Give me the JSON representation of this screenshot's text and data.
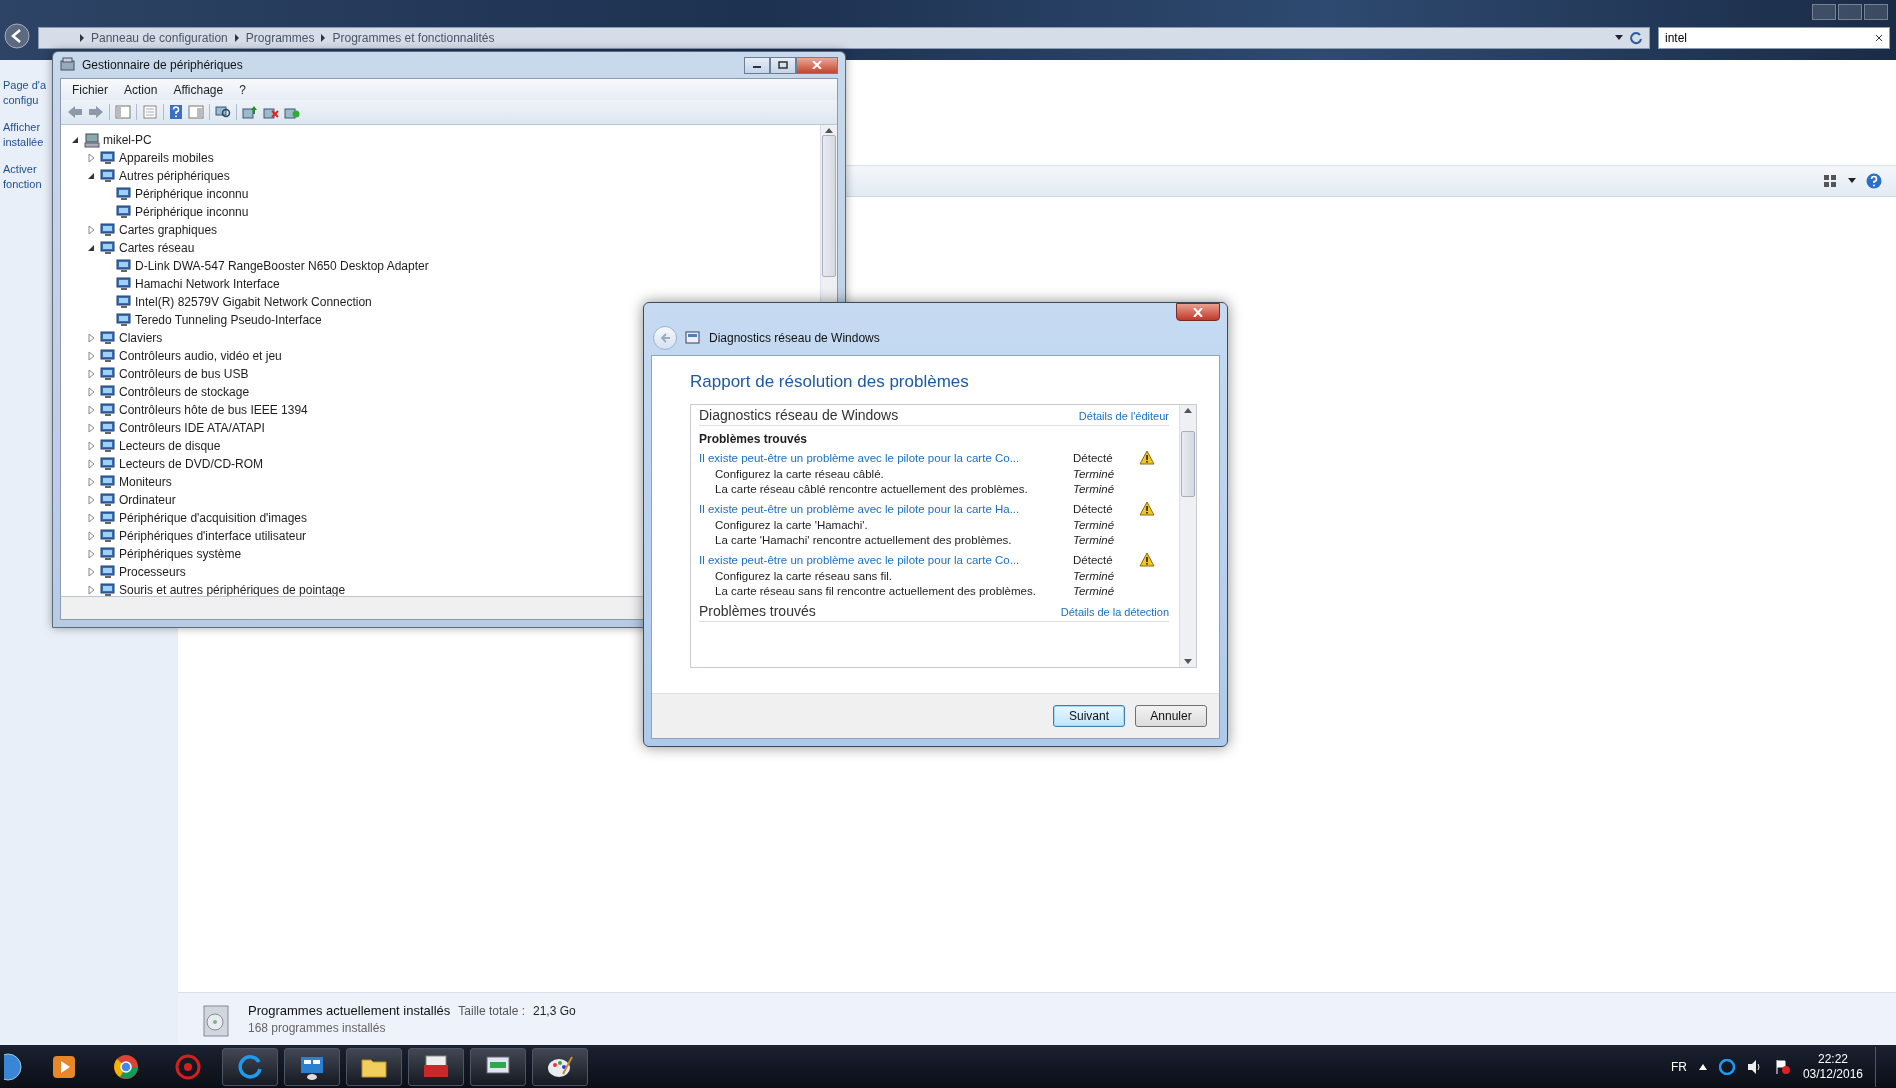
{
  "control_panel": {
    "breadcrumb": [
      "Panneau de configuration",
      "Programmes",
      "Programmes et fonctionnalités"
    ],
    "search": {
      "value": "intel"
    },
    "side_links": [
      {
        "lines": [
          "Page d'a",
          "configu"
        ]
      },
      {
        "lines": [
          "Afficher",
          "installée"
        ]
      },
      {
        "lines": [
          "Activer",
          "fonction"
        ]
      }
    ],
    "details": {
      "title": "Programmes actuellement installés",
      "size_label": "Taille totale :",
      "size_value": "21,3 Go",
      "count": "168 programmes installés"
    }
  },
  "device_manager": {
    "title": "Gestionnaire de périphériques",
    "menu": [
      "Fichier",
      "Action",
      "Affichage",
      "?"
    ],
    "tree": {
      "label": "mikel-PC",
      "expanded": true,
      "children": [
        {
          "label": "Appareils mobiles",
          "expanded": false
        },
        {
          "label": "Autres périphériques",
          "expanded": true,
          "children": [
            {
              "label": "Périphérique inconnu"
            },
            {
              "label": "Périphérique inconnu"
            }
          ]
        },
        {
          "label": "Cartes graphiques",
          "expanded": false
        },
        {
          "label": "Cartes réseau",
          "expanded": true,
          "children": [
            {
              "label": "D-Link DWA-547 RangeBooster N650 Desktop Adapter"
            },
            {
              "label": "Hamachi Network Interface"
            },
            {
              "label": "Intel(R) 82579V Gigabit Network Connection"
            },
            {
              "label": "Teredo Tunneling Pseudo-Interface"
            }
          ]
        },
        {
          "label": "Claviers",
          "expanded": false
        },
        {
          "label": "Contrôleurs audio, vidéo et jeu",
          "expanded": false
        },
        {
          "label": "Contrôleurs de bus USB",
          "expanded": false
        },
        {
          "label": "Contrôleurs de stockage",
          "expanded": false
        },
        {
          "label": "Contrôleurs hôte de bus IEEE 1394",
          "expanded": false
        },
        {
          "label": "Contrôleurs IDE ATA/ATAPI",
          "expanded": false
        },
        {
          "label": "Lecteurs de disque",
          "expanded": false
        },
        {
          "label": "Lecteurs de DVD/CD-ROM",
          "expanded": false
        },
        {
          "label": "Moniteurs",
          "expanded": false
        },
        {
          "label": "Ordinateur",
          "expanded": false
        },
        {
          "label": "Périphérique d'acquisition d'images",
          "expanded": false
        },
        {
          "label": "Périphériques d'interface utilisateur",
          "expanded": false
        },
        {
          "label": "Périphériques système",
          "expanded": false
        },
        {
          "label": "Processeurs",
          "expanded": false
        },
        {
          "label": "Souris et autres périphériques de pointage",
          "expanded": false
        }
      ]
    }
  },
  "dialog": {
    "title": "Diagnostics réseau de Windows",
    "heading": "Rapport de résolution des problèmes",
    "sections": [
      {
        "kind": "header",
        "title": "Diagnostics réseau de Windows",
        "link": "Détails de l'éditeur"
      },
      {
        "kind": "problems",
        "title": "Problèmes trouvés",
        "problems": [
          {
            "text": "Il existe peut-être un problème avec le pilote pour la carte Co...",
            "status": "Détecté",
            "steps": [
              {
                "text": "Configurez la carte réseau câblé.",
                "status": "Terminé"
              },
              {
                "text": "La carte réseau câblé rencontre actuellement des problèmes.",
                "status": "Terminé"
              }
            ]
          },
          {
            "text": "Il existe peut-être un problème avec le pilote pour la carte Ha...",
            "status": "Détecté",
            "steps": [
              {
                "text": "Configurez la carte 'Hamachi'.",
                "status": "Terminé"
              },
              {
                "text": "La carte 'Hamachi' rencontre actuellement des problèmes.",
                "status": "Terminé"
              }
            ]
          },
          {
            "text": "Il existe peut-être un problème avec le pilote pour la carte Co...",
            "status": "Détecté",
            "steps": [
              {
                "text": "Configurez la carte réseau sans fil.",
                "status": "Terminé"
              },
              {
                "text": "La carte réseau sans fil rencontre actuellement des problèmes.",
                "status": "Terminé"
              }
            ]
          }
        ]
      },
      {
        "kind": "header",
        "title": "Problèmes trouvés",
        "link": "Détails de la détection"
      }
    ],
    "buttons": [
      {
        "label": "Suivant",
        "default": true
      },
      {
        "label": "Annuler",
        "default": false
      }
    ]
  },
  "taskbar": {
    "language": "FR",
    "time": "22:22",
    "date": "03/12/2016"
  }
}
